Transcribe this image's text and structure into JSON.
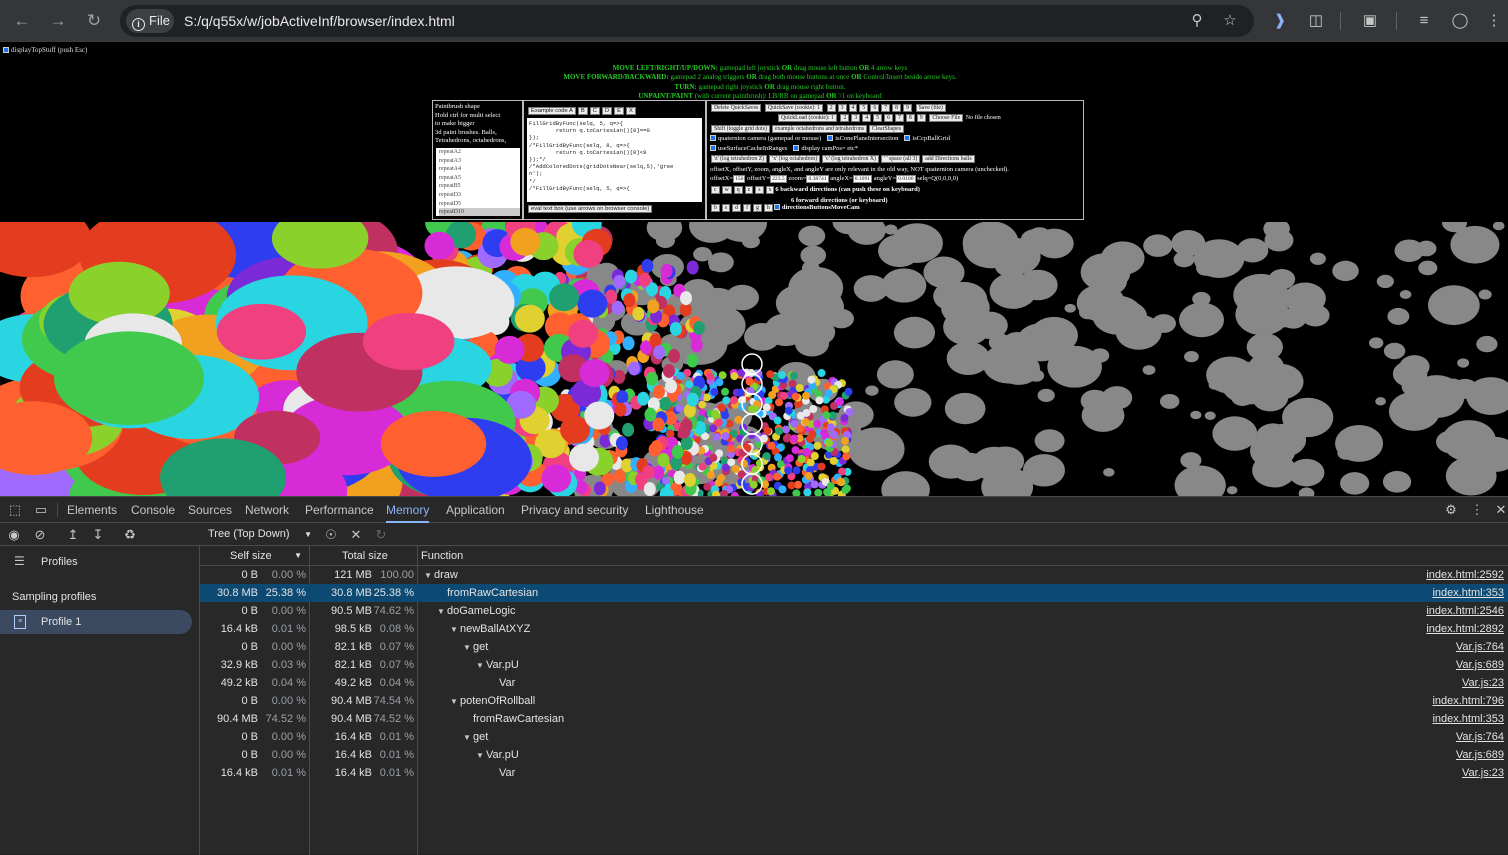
{
  "browser": {
    "url": "S:/q/q55x/w/jobActiveInf/browser/index.html",
    "scheme_label": "File",
    "icons": [
      "back-icon",
      "forward-icon",
      "reload-icon",
      "zoom-icon",
      "star-icon",
      "read-aloud-icon",
      "extensions-icon",
      "tab-search-icon",
      "reading-list-icon",
      "profile-icon",
      "menu-icon"
    ]
  },
  "page": {
    "top_checkbox": "displayTopStuff (push Esc)",
    "instructions": [
      {
        "k": "MOVE LEFT/RIGHT/UP/DOWN:",
        "v": " gamepad left joystick ",
        "o": "OR",
        "r": " drag mouse left button ",
        "o2": "OR",
        "r2": " 4 arrow keys"
      },
      {
        "k": "MOVE FORWARD/BACKWARD:",
        "v": " gamepad 2 analog triggers ",
        "o": "OR",
        "r": " drag both mouse buttons at once ",
        "o2": "OR",
        "r2": " Control/Insert beside arrow keys."
      },
      {
        "k": "TURN:",
        "v": " gamepad right joystick ",
        "o": "OR",
        "r": " drag mouse right button.",
        "o2": "",
        "r2": ""
      },
      {
        "k": "UNPAINT/PAINT",
        "v": " (with current paintbrush): LB/RB on gamepad ",
        "o": "OR",
        "r": " '/1 on keyboard",
        "o2": "",
        "r2": ""
      }
    ],
    "paintbrush": {
      "lines": [
        "Paintbrush shape",
        "Hold ctrl for multi select",
        "to make bigger",
        "3d paint brushes. Balls,",
        "Tetrahedrons, octahedrons,"
      ],
      "list": [
        "repeatA2",
        "repeatA3",
        "repeatA4",
        "repeatA5",
        "repeatB5",
        "repeatD3",
        "repeatD5",
        "repeatD10"
      ]
    },
    "code": {
      "buttons": [
        "Example code A",
        "B",
        "C",
        "D",
        "E",
        "X"
      ],
      "text": "FillGridByFunc(selq, 5, q=>{\n        return q.toCartesian()[0]==0\n});\n/*FillGridByFunc(selq, 8, q=>{\n        return q.toCartesian()[0]<8\n});*/\n/*AddColoredDots(gridDotsNear(selq,5),'gree\nn');\n*/\n/*FillGridByFunc(selq, 5, q=>{",
      "eval_button": "eval text box (use arrows on browser console)"
    },
    "controls": {
      "delete_btn": "Delete QuickSaves",
      "quicksave_btn": "QuickSave (cookie): 1",
      "quickload_btn": "QuickLoad (cookie): 1",
      "nums": [
        "2",
        "3",
        "4",
        "5",
        "6",
        "7",
        "8",
        "9"
      ],
      "save_btn": "Save (file)",
      "choose_btn": "Choose File",
      "no_file": "No file chosen",
      "row3": [
        "Shift (toggle grid dots)",
        "example octahedrons and tetrahedrons",
        "ClearShapes"
      ],
      "checks1": [
        "quaternion camera (gamepad or mouse)",
        "isConePlaneIntersection",
        "isCcpBallGrid"
      ],
      "checks2": [
        "useSurfaceCacheInRanges",
        "display camPos= etc*"
      ],
      "row6": [
        "'z' (log tetrahedron Z)",
        "'x' (log octahedron)",
        "'c' (log tetrahedron X)",
        "' ' space (all 3)",
        "add Directions balls"
      ],
      "offset_note": "offsetX, offsetY, zoom, angleX, and angleY are only relevant in the old way, NOT quaternion camera (unchecked).",
      "offset": {
        "offsetX_label": "offsetX=",
        "offsetX": "150",
        "offsetY_label": "offsetY=",
        "offsetY": "223.5",
        "zoom_label": "zoom=",
        "zoom": "0.38741",
        "angleX_label": "angleX=",
        "angleX": "0.1091",
        "angleY_label": "angleY=",
        "angleY": "0.0100",
        "selq": "selq=Q(0,0,0,0)"
      },
      "back_keys": [
        "c",
        "w",
        "q",
        "z",
        "s",
        "x"
      ],
      "back_text": "6 backward directions (can push these on keyboard)",
      "fwd_text": "6 forward directions (or keyboard)",
      "fwd_keys": [
        "b",
        "s",
        "d",
        "f",
        "g",
        "h"
      ],
      "fwd_check": "directionsButtonsMoveCam"
    }
  },
  "devtools": {
    "tabs": [
      "Elements",
      "Console",
      "Sources",
      "Network",
      "Performance",
      "Memory",
      "Application",
      "Privacy and security",
      "Lighthouse"
    ],
    "active_tab": "Memory",
    "view_select": "Tree (Top Down)",
    "sidebar": {
      "profiles": "Profiles",
      "section": "Sampling profiles",
      "profile": "Profile 1"
    },
    "columns": {
      "self": "Self size",
      "total": "Total size",
      "function": "Function"
    },
    "rows": [
      {
        "self": "0 B",
        "selfp": "0.00 %",
        "total": "121 MB",
        "totalp": "100.00 %",
        "fn": "draw",
        "depth": 0,
        "arrow": true,
        "url": "index.html:2592"
      },
      {
        "self": "30.8 MB",
        "selfp": "25.38 %",
        "total": "30.8 MB",
        "totalp": "25.38 %",
        "fn": "fromRawCartesian",
        "depth": 1,
        "arrow": false,
        "url": "index.html:353",
        "sel": true
      },
      {
        "self": "0 B",
        "selfp": "0.00 %",
        "total": "90.5 MB",
        "totalp": "74.62 %",
        "fn": "doGameLogic",
        "depth": 1,
        "arrow": true,
        "url": "index.html:2546"
      },
      {
        "self": "16.4 kB",
        "selfp": "0.01 %",
        "total": "98.5 kB",
        "totalp": "0.08 %",
        "fn": "newBallAtXYZ",
        "depth": 2,
        "arrow": true,
        "url": "index.html:2892"
      },
      {
        "self": "0 B",
        "selfp": "0.00 %",
        "total": "82.1 kB",
        "totalp": "0.07 %",
        "fn": "get",
        "depth": 3,
        "arrow": true,
        "url": "Var.js:764"
      },
      {
        "self": "32.9 kB",
        "selfp": "0.03 %",
        "total": "82.1 kB",
        "totalp": "0.07 %",
        "fn": "Var.pU",
        "depth": 4,
        "arrow": true,
        "url": "Var.js:689"
      },
      {
        "self": "49.2 kB",
        "selfp": "0.04 %",
        "total": "49.2 kB",
        "totalp": "0.04 %",
        "fn": "Var",
        "depth": 5,
        "arrow": false,
        "url": "Var.js:23"
      },
      {
        "self": "0 B",
        "selfp": "0.00 %",
        "total": "90.4 MB",
        "totalp": "74.54 %",
        "fn": "potenOfRollball",
        "depth": 2,
        "arrow": true,
        "url": "index.html:796"
      },
      {
        "self": "90.4 MB",
        "selfp": "74.52 %",
        "total": "90.4 MB",
        "totalp": "74.52 %",
        "fn": "fromRawCartesian",
        "depth": 3,
        "arrow": false,
        "url": "index.html:353"
      },
      {
        "self": "0 B",
        "selfp": "0.00 %",
        "total": "16.4 kB",
        "totalp": "0.01 %",
        "fn": "get",
        "depth": 3,
        "arrow": true,
        "url": "Var.js:764"
      },
      {
        "self": "0 B",
        "selfp": "0.00 %",
        "total": "16.4 kB",
        "totalp": "0.01 %",
        "fn": "Var.pU",
        "depth": 4,
        "arrow": true,
        "url": "Var.js:689"
      },
      {
        "self": "16.4 kB",
        "selfp": "0.01 %",
        "total": "16.4 kB",
        "totalp": "0.01 %",
        "fn": "Var",
        "depth": 5,
        "arrow": false,
        "url": "Var.js:23"
      }
    ]
  }
}
